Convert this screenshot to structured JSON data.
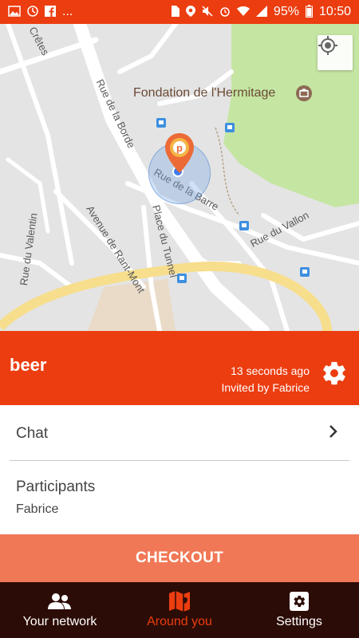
{
  "status_bar": {
    "battery": "95%",
    "time": "10:50",
    "more": "..."
  },
  "map": {
    "poi": "Fondation de l'Hermitage",
    "streets": [
      "Crêtes",
      "Rue de la Borde",
      "Rue de la Barre",
      "Avenue de Rant-Mont",
      "Place du Tunnel",
      "Rue du Valentin",
      "Rue du Vallon"
    ]
  },
  "event": {
    "title": "beer",
    "time_ago": "13 seconds ago",
    "invited_by": "Invited by Fabrice"
  },
  "chat": {
    "label": "Chat"
  },
  "participants": {
    "title": "Participants",
    "names": [
      "Fabrice"
    ]
  },
  "checkout": {
    "label": "CHECKOUT"
  },
  "tabs": [
    {
      "label": "Your network",
      "icon": "people-icon",
      "active": false
    },
    {
      "label": "Around you",
      "icon": "map-icon",
      "active": true
    },
    {
      "label": "Settings",
      "icon": "gear-icon",
      "active": false
    }
  ],
  "colors": {
    "brand": "#ec3d10",
    "checkout": "#f07856",
    "tabbar": "#2c0c06",
    "park": "#c5e5a3"
  }
}
